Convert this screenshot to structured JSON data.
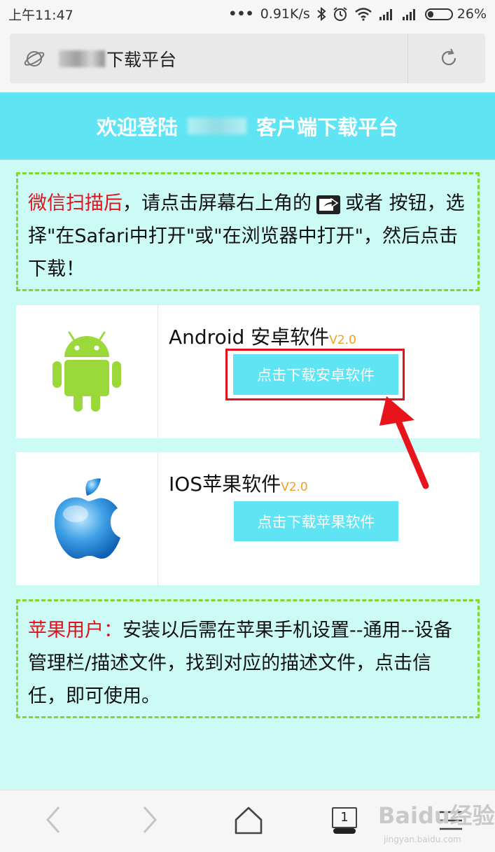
{
  "status_bar": {
    "time": "上午11:47",
    "dots": "•••",
    "speed": "0.91K/s",
    "battery": "26%",
    "battery_level": 0.26,
    "icons": [
      "bluetooth-icon",
      "alarm-icon",
      "wifi-icon",
      "signal-icon",
      "signal-icon",
      "battery-icon"
    ]
  },
  "address_bar": {
    "text": "下载平台",
    "icons": [
      "globe-icon",
      "refresh-icon"
    ]
  },
  "banner": {
    "left": "欢迎登陆",
    "right": "客户端下载平台"
  },
  "notice_top": {
    "highlight": "微信扫描后",
    "text_a": "，请点击屏幕右上角的",
    "text_b": "或者 按钮，选择\"在Safari中打开\"或\"在浏览器中打开\"，然后点击下载！"
  },
  "android_card": {
    "title": "Android 安卓软件",
    "version": "V2.0",
    "button": "点击下载安卓软件"
  },
  "ios_card": {
    "title": "IOS苹果软件",
    "version": "V2.0",
    "button": "点击下载苹果软件"
  },
  "notice_bottom": {
    "highlight": "苹果用户：",
    "text": "安装以后需在苹果手机设置--通用--设备管理栏/描述文件，找到对应的描述文件，点击信任，即可使用。"
  },
  "bottom_nav": {
    "tab_count": "1",
    "watermark": "Baidu经验",
    "watermark_sub": "jingyan.baidu.com"
  },
  "colors": {
    "accent": "#5ee4f2",
    "page_bg": "#ccfbf6",
    "highlight_red": "#e0121d",
    "dashed_border": "#7fd730",
    "version": "#f0a01e",
    "android_green": "#9bd83a",
    "apple_blue": "#3ea0e6"
  }
}
